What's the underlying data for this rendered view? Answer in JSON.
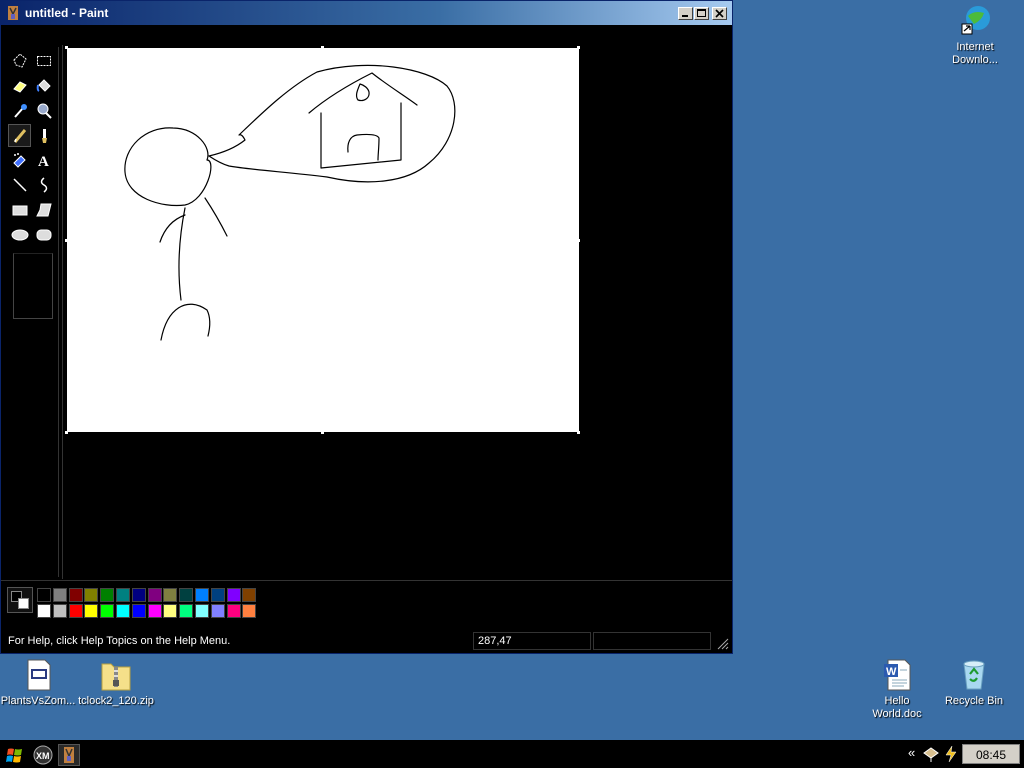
{
  "window": {
    "title": "untitled - Paint"
  },
  "statusbar": {
    "help_text": "For Help, click Help Topics on the Help Menu.",
    "coords": "287,47"
  },
  "desktop": {
    "icons": [
      {
        "label": "Internet Downlo..."
      },
      {
        "label": "PlantsVsZom..."
      },
      {
        "label": "tclock2_120.zip"
      },
      {
        "label": "Hello World.doc"
      },
      {
        "label": "Recycle Bin"
      }
    ]
  },
  "taskbar": {
    "clock": "08:45",
    "tray_arrow": "«"
  },
  "palette": {
    "foreground": "#000000",
    "background": "#ffffff",
    "row1": [
      "#000000",
      "#808080",
      "#800000",
      "#808000",
      "#008000",
      "#008080",
      "#000080",
      "#800080",
      "#808040",
      "#004040",
      "#0080ff",
      "#004080",
      "#8000ff",
      "#804000"
    ],
    "row2": [
      "#ffffff",
      "#c0c0c0",
      "#ff0000",
      "#ffff00",
      "#00ff00",
      "#00ffff",
      "#0000ff",
      "#ff00ff",
      "#ffff80",
      "#00ff80",
      "#80ffff",
      "#8080ff",
      "#ff0080",
      "#ff8040"
    ]
  },
  "tools": [
    "free-form-select-icon",
    "select-icon",
    "eraser-icon",
    "fill-icon",
    "pick-color-icon",
    "magnifier-icon",
    "pencil-icon",
    "brush-icon",
    "airbrush-icon",
    "text-icon",
    "line-icon",
    "curve-icon",
    "rectangle-icon",
    "polygon-icon",
    "ellipse-icon",
    "rounded-rectangle-icon"
  ]
}
